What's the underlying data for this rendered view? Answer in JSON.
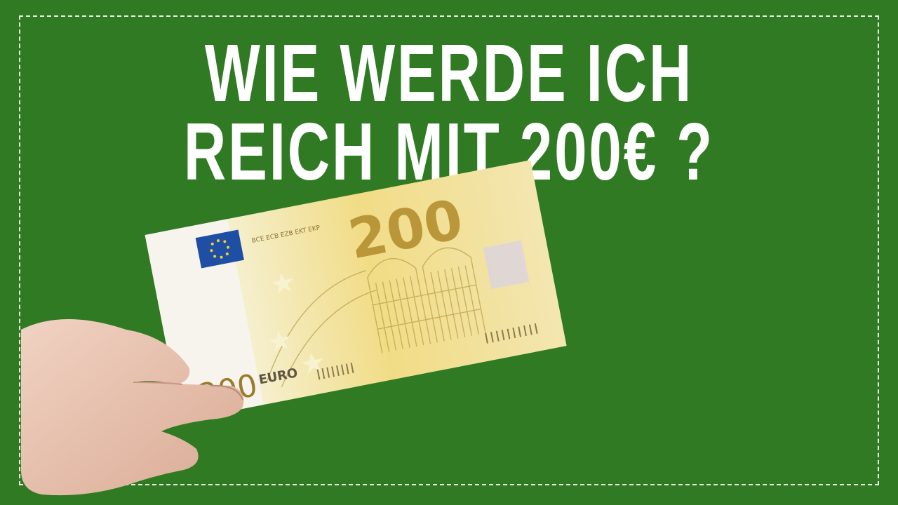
{
  "title": {
    "line1": "WIE WERDE ICH",
    "line2": "REICH MIT 200€ ?"
  },
  "banknote": {
    "value_top": "200",
    "value_bottom": "200",
    "currency": "EURO",
    "serial_header": "BCE ECB EZB EKT EKP",
    "accent_color": "#e8d57a"
  },
  "colors": {
    "background": "#2f7a23",
    "text": "#ffffff",
    "border": "#e8f0e4"
  }
}
